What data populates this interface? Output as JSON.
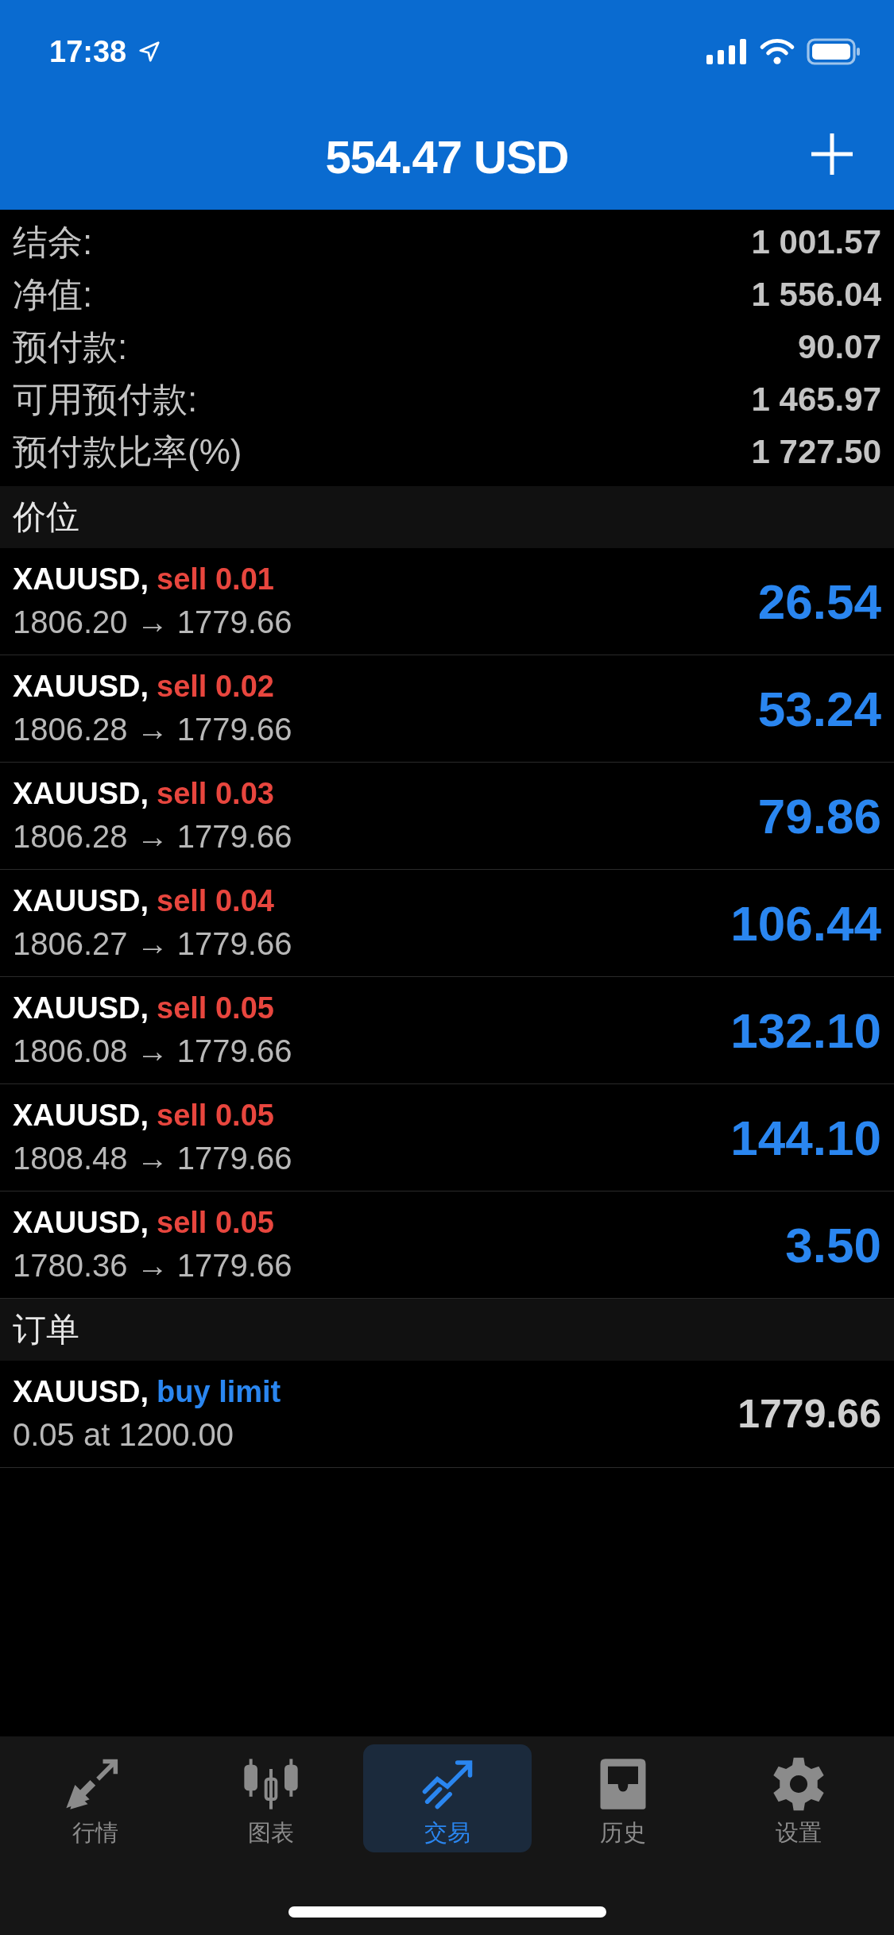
{
  "status_bar": {
    "time": "17:38"
  },
  "header": {
    "title": "554.47 USD"
  },
  "summary": [
    {
      "label": "结余:",
      "value": "1 001.57"
    },
    {
      "label": "净值:",
      "value": "1 556.04"
    },
    {
      "label": "预付款:",
      "value": "90.07"
    },
    {
      "label": "可用预付款:",
      "value": "1 465.97"
    },
    {
      "label": "预付款比率(%)",
      "value": "1 727.50"
    }
  ],
  "sections": [
    {
      "title": "价位",
      "kind": "positions",
      "rows": [
        {
          "symbol": "XAUUSD,",
          "kind": "sell",
          "trade": "sell 0.01",
          "detail": "1806.20 → 1779.66",
          "value": "26.54"
        },
        {
          "symbol": "XAUUSD,",
          "kind": "sell",
          "trade": "sell 0.02",
          "detail": "1806.28 → 1779.66",
          "value": "53.24"
        },
        {
          "symbol": "XAUUSD,",
          "kind": "sell",
          "trade": "sell 0.03",
          "detail": "1806.28 → 1779.66",
          "value": "79.86"
        },
        {
          "symbol": "XAUUSD,",
          "kind": "sell",
          "trade": "sell 0.04",
          "detail": "1806.27 → 1779.66",
          "value": "106.44"
        },
        {
          "symbol": "XAUUSD,",
          "kind": "sell",
          "trade": "sell 0.05",
          "detail": "1806.08 → 1779.66",
          "value": "132.10"
        },
        {
          "symbol": "XAUUSD,",
          "kind": "sell",
          "trade": "sell 0.05",
          "detail": "1808.48 → 1779.66",
          "value": "144.10"
        },
        {
          "symbol": "XAUUSD,",
          "kind": "sell",
          "trade": "sell 0.05",
          "detail": "1780.36 → 1779.66",
          "value": "3.50"
        }
      ]
    },
    {
      "title": "订单",
      "kind": "orders",
      "rows": [
        {
          "symbol": "XAUUSD,",
          "kind": "buy",
          "trade": "buy limit",
          "detail": "0.05 at 1200.00",
          "value": "1779.66"
        }
      ]
    }
  ],
  "tabs": [
    {
      "label": "行情",
      "selected": false
    },
    {
      "label": "图表",
      "selected": false
    },
    {
      "label": "交易",
      "selected": true
    },
    {
      "label": "历史",
      "selected": false
    },
    {
      "label": "设置",
      "selected": false
    }
  ]
}
